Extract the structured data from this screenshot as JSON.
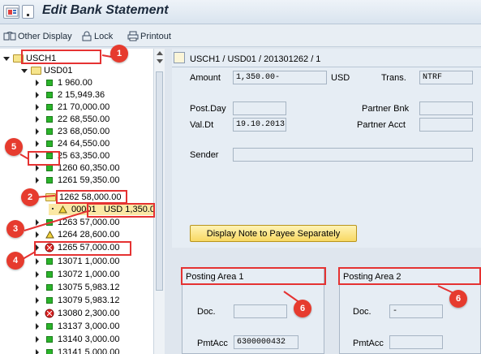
{
  "window": {
    "title": "Edit Bank Statement"
  },
  "toolbar": {
    "other_display": "Other Display",
    "lock": "Lock",
    "printout": "Printout"
  },
  "tree": {
    "root": "USCH1",
    "account": "USD01",
    "items": [
      {
        "label": "1 960.00",
        "status": "green"
      },
      {
        "label": "2 15,949.36",
        "status": "green"
      },
      {
        "label": "21 70,000.00",
        "status": "green"
      },
      {
        "label": "22 68,550.00",
        "status": "green"
      },
      {
        "label": "23 68,050.00",
        "status": "green"
      },
      {
        "label": "24 64,550.00",
        "status": "green"
      },
      {
        "label": "25 63,350.00",
        "status": "green"
      },
      {
        "label": "1260 60,350.00",
        "status": "green"
      },
      {
        "label": "1261 59,350.00",
        "status": "green"
      },
      {
        "label": "1262 58,000.00",
        "status": "open"
      },
      {
        "label": "00001",
        "amount": "USD 1,350.0",
        "status": "warning"
      },
      {
        "label": "1263 57,000.00",
        "status": "green"
      },
      {
        "label": "1264 28,600.00",
        "status": "warning"
      },
      {
        "label": "1265 57,000.00",
        "status": "error"
      },
      {
        "label": "13071 1,000.00",
        "status": "green"
      },
      {
        "label": "13072 1,000.00",
        "status": "green"
      },
      {
        "label": "13075 5,983.12",
        "status": "green"
      },
      {
        "label": "13079 5,983.12",
        "status": "green"
      },
      {
        "label": "13080 2,300.00",
        "status": "error"
      },
      {
        "label": "13137 3,000.00",
        "status": "green"
      },
      {
        "label": "13140 3,000.00",
        "status": "green"
      },
      {
        "label": "13141 5,000.00",
        "status": "green"
      }
    ]
  },
  "detail": {
    "header": "USCH1 / USD01 / 201301262 / 1",
    "amount_label": "Amount",
    "amount_value": "1,350.00-",
    "currency": "USD",
    "trans_label": "Trans.",
    "trans_value": "NTRF",
    "post_day_label": "Post.Day",
    "post_day_value": "",
    "partner_bnk_label": "Partner Bnk",
    "partner_bnk_value": "",
    "val_dt_label": "Val.Dt",
    "val_dt_value": "19.10.2013",
    "partner_acct_label": "Partner Acct",
    "partner_acct_value": "",
    "sender_label": "Sender",
    "sender_value": "",
    "note_button": "Display Note to Payee Separately"
  },
  "posting_area_1": {
    "title": "Posting Area 1",
    "doc_label": "Doc.",
    "doc_value": "",
    "pmtacc_label": "PmtAcc",
    "pmtacc_value": "6300000432"
  },
  "posting_area_2": {
    "title": "Posting Area 2",
    "doc_label": "Doc.",
    "doc_value": "-",
    "pmtacc_label": "PmtAcc",
    "pmtacc_value": ""
  },
  "annotations": [
    "1",
    "2",
    "3",
    "4",
    "5",
    "6",
    "6"
  ],
  "colors": {
    "annotation": "#e53232",
    "status_green": "#2ab42a",
    "status_error": "#e02020",
    "status_warning": "#f3d33c"
  }
}
